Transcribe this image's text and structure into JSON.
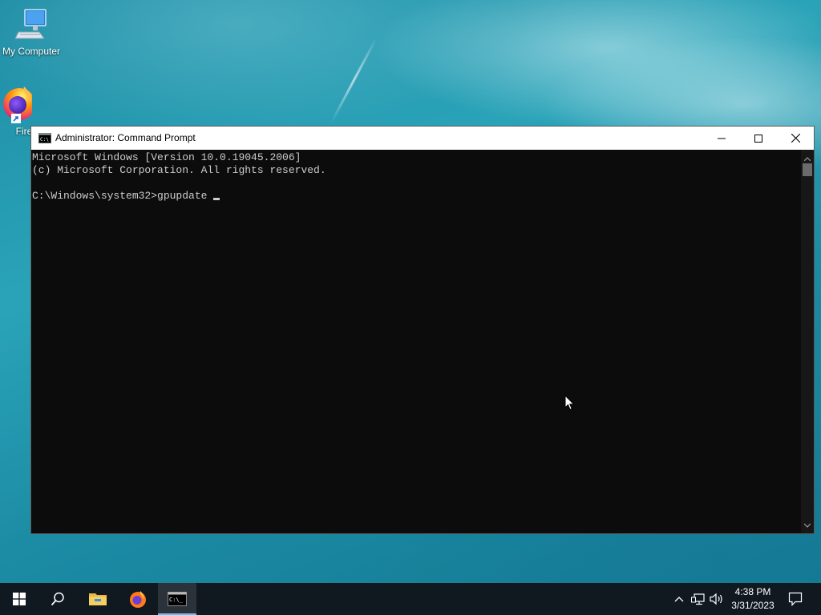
{
  "desktop": {
    "icons": [
      {
        "label": "My Computer",
        "icon": "computer-icon"
      },
      {
        "label": "Fire",
        "icon": "firefox-icon"
      }
    ]
  },
  "window": {
    "title": "Administrator: Command Prompt",
    "icon": "cmd-icon",
    "controls": {
      "minimize": "minimize-icon",
      "maximize": "maximize-icon",
      "close": "close-icon"
    }
  },
  "console": {
    "lines": [
      "Microsoft Windows [Version 10.0.19045.2006]",
      "(c) Microsoft Corporation. All rights reserved.",
      "",
      "C:\\Windows\\system32>gpupdate"
    ]
  },
  "taskbar": {
    "items": [
      "windows-start-icon",
      "search-icon",
      "file-explorer-icon",
      "firefox-icon",
      "cmd-icon"
    ],
    "tray": {
      "icons": [
        "chevron-up-icon",
        "network-icon",
        "volume-icon",
        "notification-icon"
      ],
      "time": "4:38 PM",
      "date": "3/31/2023"
    }
  },
  "colors": {
    "console_bg": "#0c0c0c",
    "console_fg": "#cccccc",
    "taskbar_bg": "#101820",
    "active_indicator": "#76b9ed"
  }
}
